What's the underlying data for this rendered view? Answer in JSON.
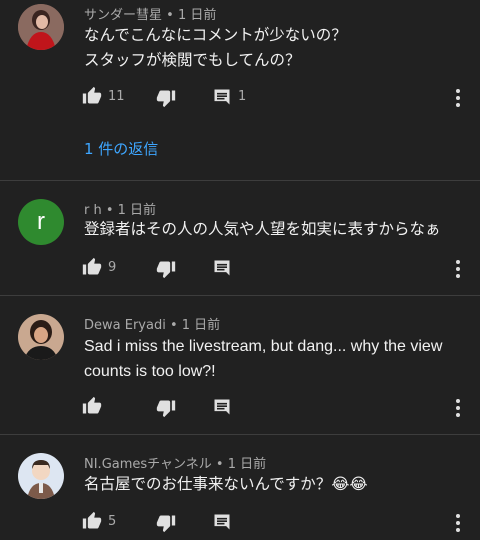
{
  "comments": [
    {
      "author": "サンダー彗星",
      "sep": " • ",
      "time": "1 日前",
      "lines": [
        "なんでこんなにコメントが少ないの？",
        "スタッフが検閲でもしてんの？"
      ],
      "likes": "11",
      "reply_count": "1",
      "avatar": "photo",
      "replies_label": "1 件の返信"
    },
    {
      "author": "r h",
      "sep": " • ",
      "time": "1 日前",
      "lines": [
        "登録者はその人の人気や人望を如実に表すからなぁ"
      ],
      "likes": "9",
      "avatar_letter": "r",
      "avatar_color": "#2f8a2f"
    },
    {
      "author": "Dewa Eryadi",
      "sep": " • ",
      "time": "1 日前",
      "lines": [
        "Sad i miss the livestream, but dang... why the view",
        "counts is too low?!"
      ],
      "likes": "",
      "avatar": "photo"
    },
    {
      "author": "NI.Gamesチャンネル",
      "sep": " • ",
      "time": "1 日前",
      "lines": [
        "名古屋でのお仕事来ないんですか？😂😂"
      ],
      "likes": "5",
      "avatar": "illustration"
    }
  ],
  "icons": {
    "like": "thumb-up-icon",
    "dislike": "thumb-down-icon",
    "reply": "comment-icon",
    "more": "more-vertical-icon"
  },
  "colors": {
    "background": "#212121",
    "link": "#3ea6ff",
    "meta": "#aaaaaa"
  }
}
